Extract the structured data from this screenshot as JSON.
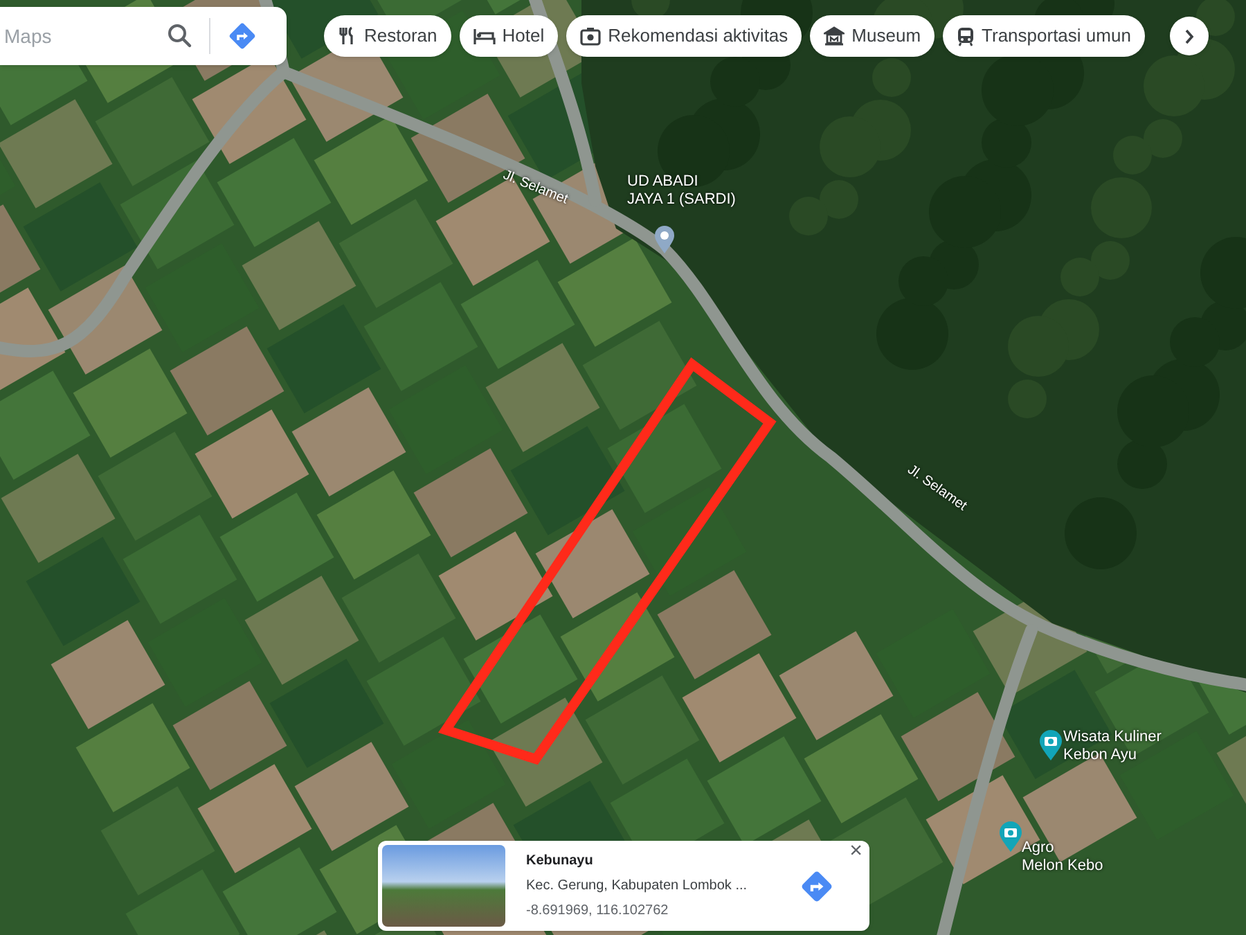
{
  "search": {
    "placeholder": "Maps"
  },
  "category_chips": [
    {
      "label": "Restoran",
      "kind": "restaurant"
    },
    {
      "label": "Hotel",
      "kind": "hotel"
    },
    {
      "label": "Rekomendasi aktivitas",
      "kind": "camera"
    },
    {
      "label": "Museum",
      "kind": "museum"
    },
    {
      "label": "Transportasi umun",
      "kind": "transit"
    }
  ],
  "map": {
    "road_labels": [
      "Jl. Selamet",
      "Jl. Selamet"
    ],
    "places": [
      {
        "kind": "pin",
        "lines": [
          "UD ABADI",
          "JAYA 1 (SARDI)"
        ]
      },
      {
        "kind": "camera",
        "lines": [
          "Wisata Kuliner",
          "Kebon Ayu"
        ]
      },
      {
        "kind": "camera",
        "lines": [
          "Agro",
          "Melon Kebo"
        ]
      }
    ]
  },
  "place_card": {
    "title": "Kebunayu",
    "address": "Kec. Gerung, Kabupaten Lombok ...",
    "coordinates": "-8.691969, 116.102762",
    "close": "×"
  }
}
